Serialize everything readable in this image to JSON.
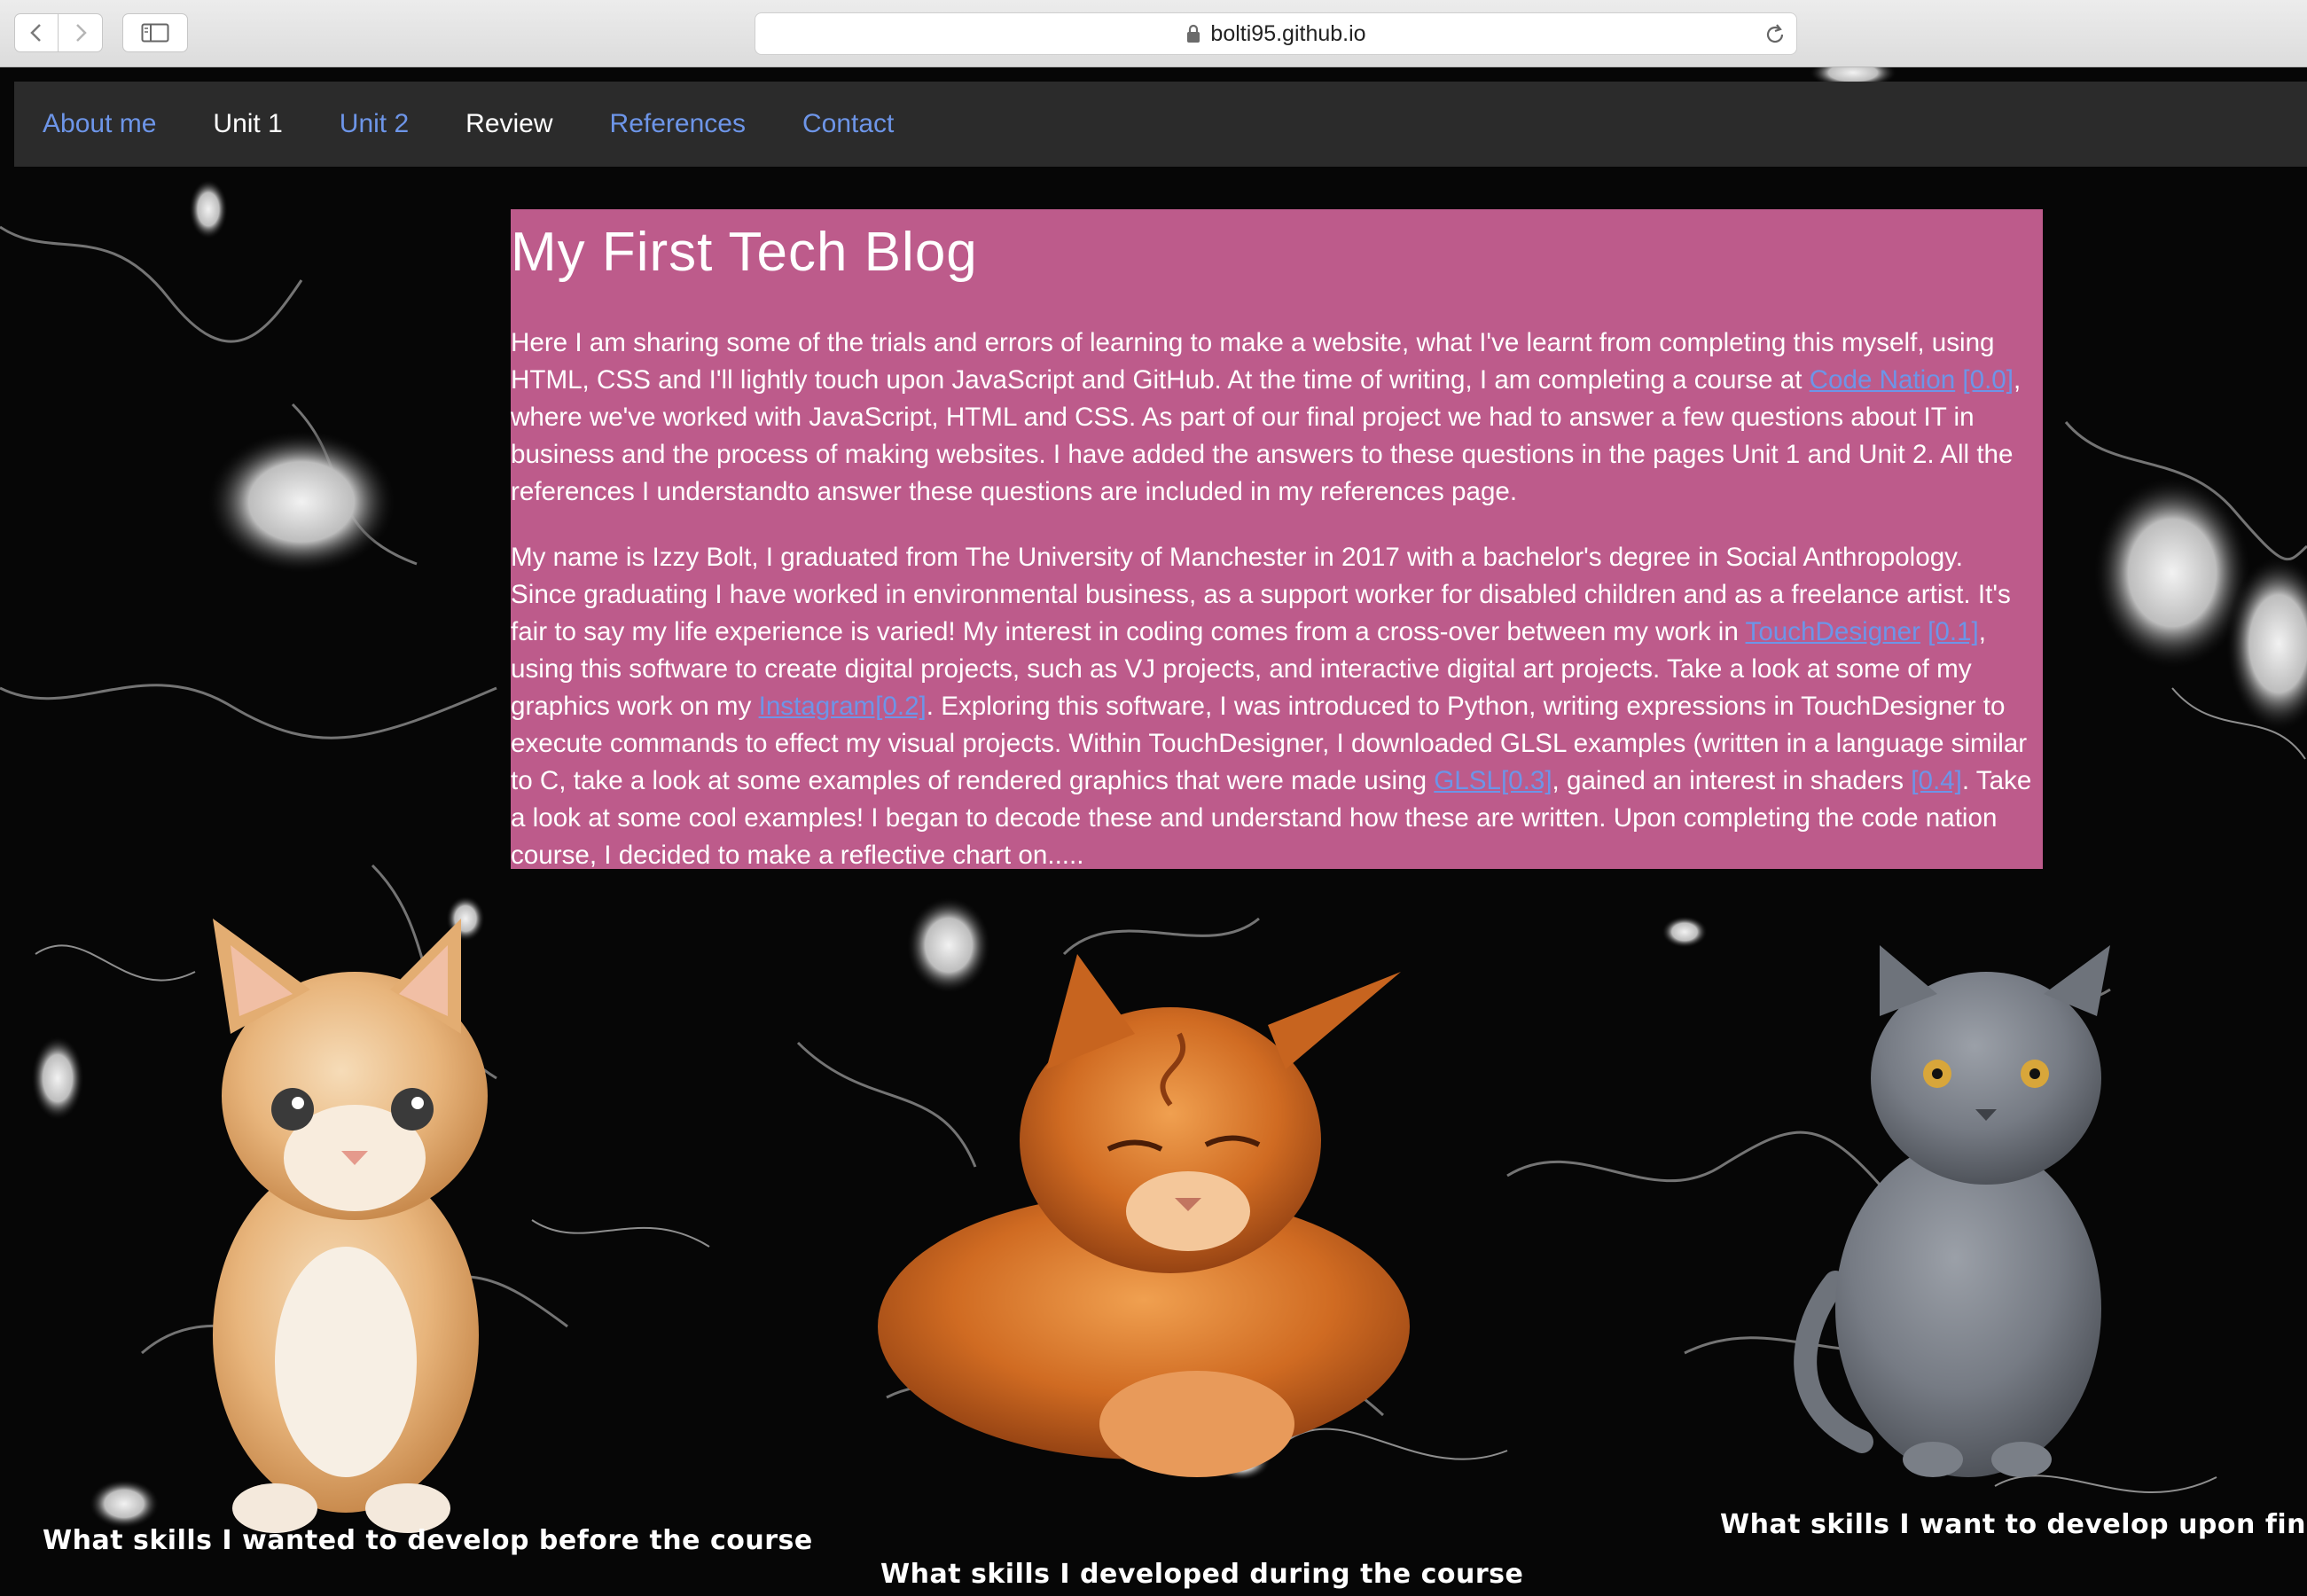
{
  "browser": {
    "url": "bolti95.github.io"
  },
  "nav": {
    "items": [
      {
        "label": "About me",
        "style": "link"
      },
      {
        "label": "Unit 1",
        "style": "plain"
      },
      {
        "label": "Unit 2",
        "style": "link"
      },
      {
        "label": "Review",
        "style": "plain"
      },
      {
        "label": "References",
        "style": "link"
      },
      {
        "label": "Contact",
        "style": "link"
      }
    ]
  },
  "blog": {
    "title": "My First Tech Blog",
    "p1": {
      "t1": "Here I am sharing some of the trials and errors of learning to make a website, what I've learnt from completing this myself, using HTML, CSS and I'll lightly touch upon JavaScript and GitHub. At the time of writing, I am completing a course at ",
      "link_code_nation": "Code Nation",
      "ref_00": "[0.0]",
      "t2": ", where we've worked with JavaScript, HTML and CSS. As part of our final project we had to answer a few questions about IT in business and the process of making websites. I have added the answers to these questions in the pages Unit 1 and Unit 2. All the references I understandto answer these questions are included in my references page."
    },
    "p2": {
      "t1": "My name is Izzy Bolt, I graduated from The University of Manchester in 2017 with a bachelor's degree in Social Anthropology. Since graduating I have worked in environmental business, as a support worker for disabled children and as a freelance artist. It's fair to say my life experience is varied! My interest in coding comes from a cross-over between my work in ",
      "link_touchdesigner": "TouchDesigner",
      "ref_01": "[0.1]",
      "t2": ", using this software to create digital projects, such as VJ projects, and interactive digital art projects. Take a look at some of my graphics work on my ",
      "link_instagram": "Instagram[0.2]",
      "t3": ". Exploring this software, I was introduced to Python, writing expressions in TouchDesigner to execute commands to effect my visual projects. Within TouchDesigner, I downloaded GLSL examples (written in a language similar to C, take a look at some examples of rendered graphics that were made using ",
      "link_glsl": "GLSL[0.3]",
      "t4": ", gained an interest in shaders ",
      "ref_04": "[0.4]",
      "t5": ". Take a look at some cool examples! I began to decode these and understand how these are written. Upon completing the code nation course, I decided to make a reflective chart on....."
    }
  },
  "cats": {
    "left_caption": "What skills I wanted to develop before the course",
    "middle_caption": "What skills I developed during the course",
    "right_caption": "What skills I want to develop upon finishing"
  },
  "colors": {
    "content_bg": "#bd5b8b",
    "nav_bg": "#2b2b2b",
    "link": "#6d95e8"
  }
}
